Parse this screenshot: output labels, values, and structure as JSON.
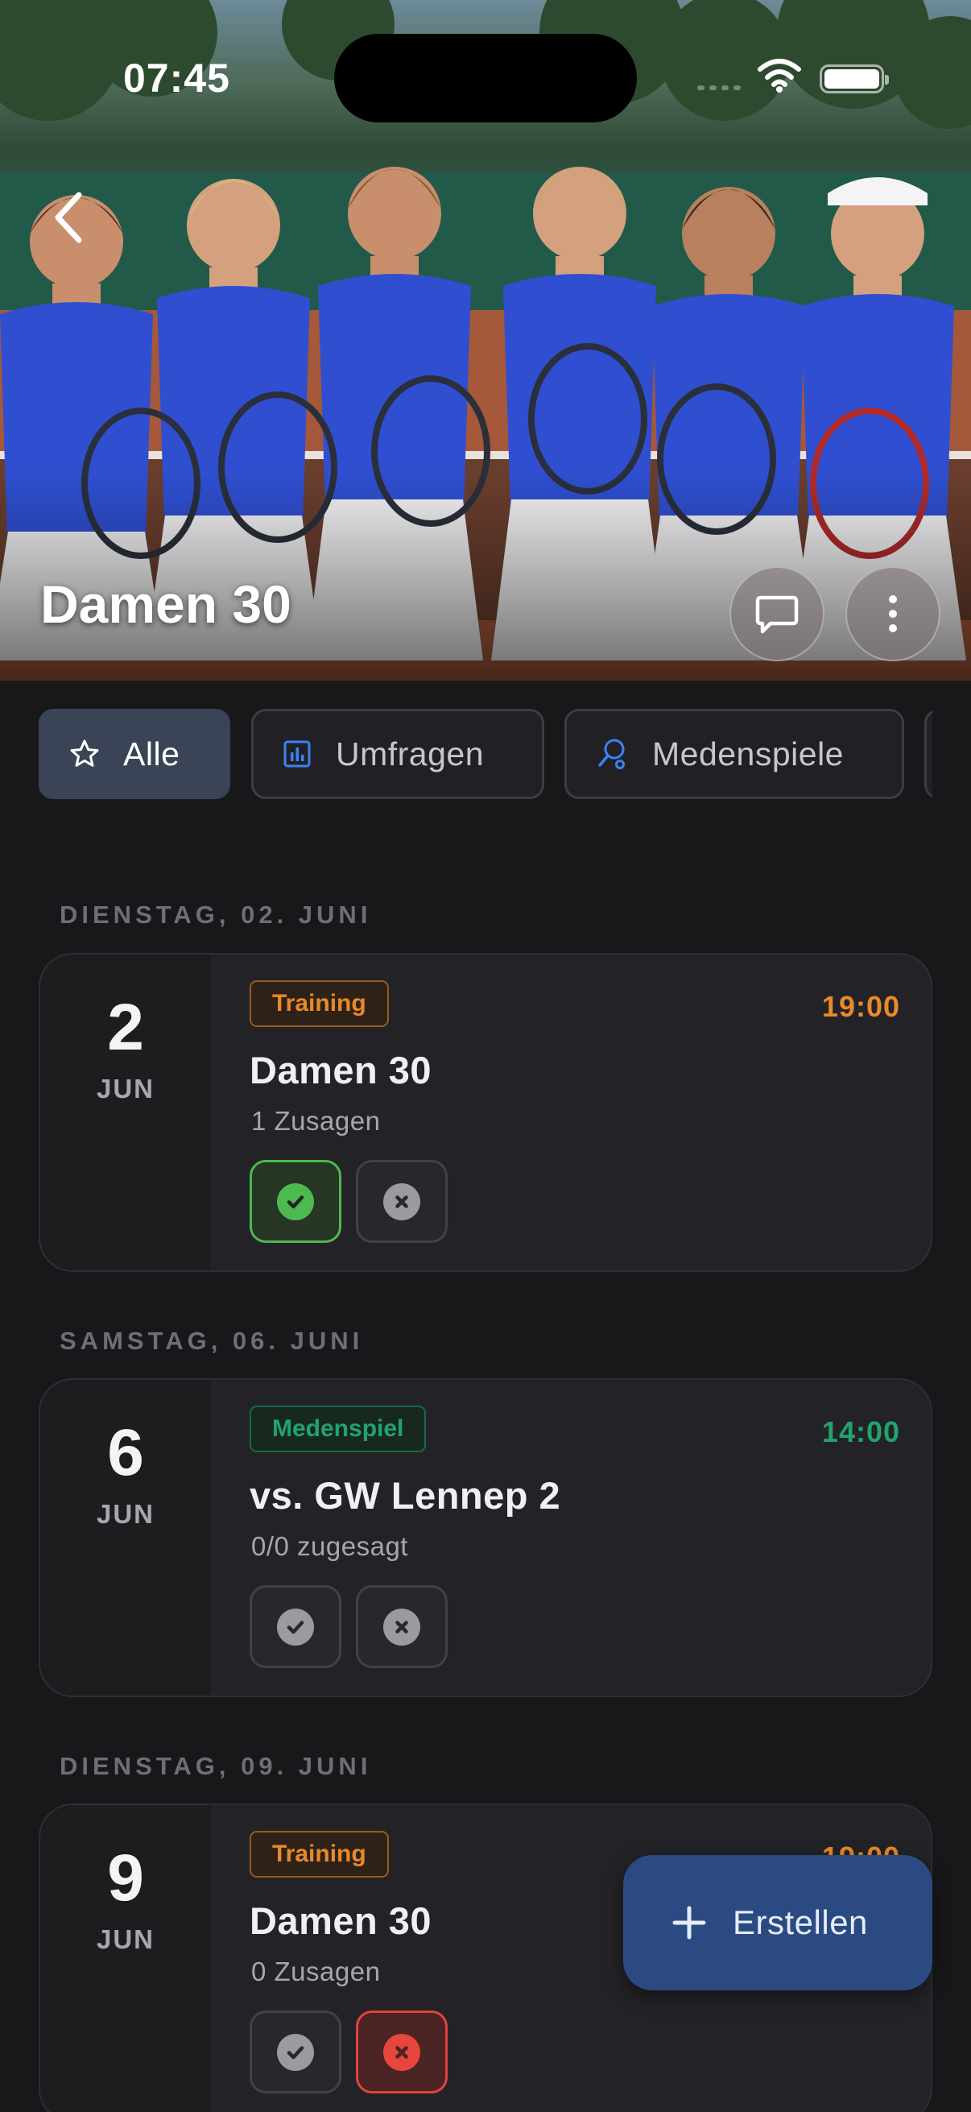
{
  "status_bar": {
    "time": "07:45"
  },
  "header": {
    "title": "Damen 30"
  },
  "filters": [
    {
      "label": "Alle",
      "icon": "star-icon",
      "active": true
    },
    {
      "label": "Umfragen",
      "icon": "poll-chart-icon",
      "active": false
    },
    {
      "label": "Medenspiele",
      "icon": "tennis-racket-icon",
      "active": false
    }
  ],
  "events": [
    {
      "section": "DIENSTAG, 02. JUNI",
      "day": "2",
      "month": "JUN",
      "type": "Training",
      "time": "19:00",
      "title": "Damen 30",
      "subtitle": "1 Zusagen",
      "response": "yes"
    },
    {
      "section": "SAMSTAG, 06. JUNI",
      "day": "6",
      "month": "JUN",
      "type": "Medenspiel",
      "time": "14:00",
      "title": "vs. GW Lennep 2",
      "subtitle": "0/0 zugesagt",
      "response": "none"
    },
    {
      "section": "DIENSTAG, 09. JUNI",
      "day": "9",
      "month": "JUN",
      "type": "Training",
      "time": "19:00",
      "title": "Damen 30",
      "subtitle": "0 Zusagen",
      "response": "no"
    }
  ],
  "fab": {
    "label": "Erstellen",
    "icon": "plus-icon"
  },
  "colors": {
    "training": "#e8892b",
    "match": "#22a36e",
    "accept": "#4cba4f",
    "decline": "#e8453d",
    "fab": "#2b4a82"
  }
}
